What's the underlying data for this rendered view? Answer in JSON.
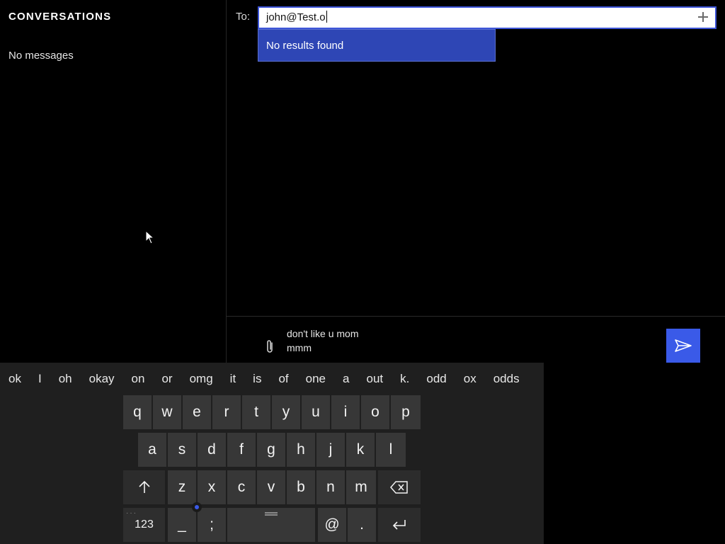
{
  "sidebar": {
    "title": "CONVERSATIONS",
    "empty_text": "No messages"
  },
  "header": {
    "to_label": "To:",
    "recipient_value": "john@Test.o",
    "suggest_text": "No results found"
  },
  "compose": {
    "line1": "don't like u mom",
    "line2": "mmm"
  },
  "keyboard": {
    "suggestions": [
      "ok",
      "I",
      "oh",
      "okay",
      "on",
      "or",
      "omg",
      "it",
      "is",
      "of",
      "one",
      "a",
      "out",
      "k.",
      "odd",
      "ox",
      "odds"
    ],
    "row1": [
      "q",
      "w",
      "e",
      "r",
      "t",
      "y",
      "u",
      "i",
      "o",
      "p"
    ],
    "row2": [
      "a",
      "s",
      "d",
      "f",
      "g",
      "h",
      "j",
      "k",
      "l"
    ],
    "row3": [
      "z",
      "x",
      "c",
      "v",
      "b",
      "n",
      "m"
    ],
    "numbers_label": "123",
    "underscore": "_",
    "semicolon": ";",
    "at": "@",
    "period": "."
  },
  "icons": {
    "add": "plus-icon",
    "attach": "paperclip-icon",
    "send": "send-icon",
    "shift": "shift-arrow-icon",
    "backspace": "backspace-icon",
    "enter": "enter-icon"
  },
  "colors": {
    "accent": "#3a5ae8",
    "suggest_bg": "#2e46b5",
    "keyboard_bg": "#1f1f1f",
    "key_bg": "#373737"
  }
}
